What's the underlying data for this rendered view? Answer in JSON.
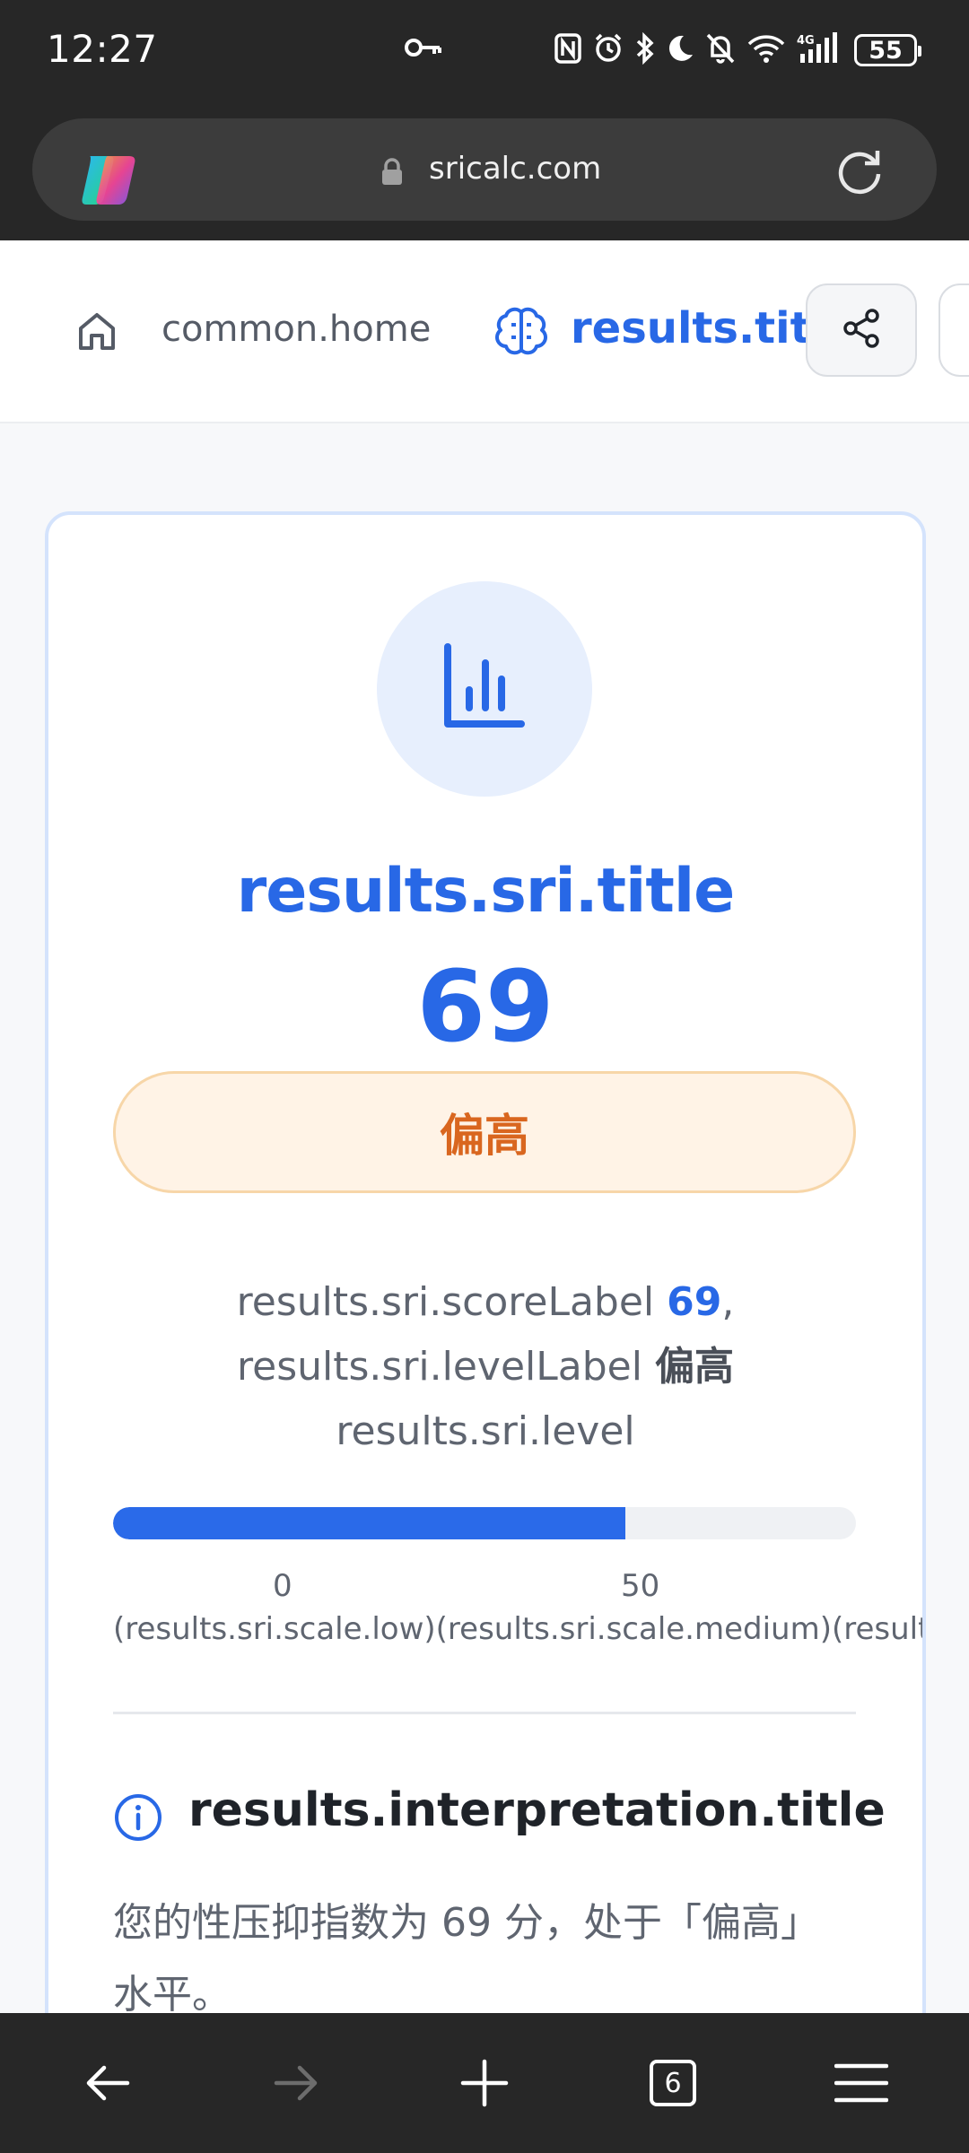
{
  "status_bar": {
    "time": "12:27",
    "battery": "55"
  },
  "browser": {
    "url": "sricalc.com",
    "tab_count": "6"
  },
  "nav": {
    "home_label": "common.home",
    "results_label": "results.title"
  },
  "result_card": {
    "title": "results.sri.title",
    "score": "69",
    "level": "偏高",
    "description": {
      "score_label": "results.sri.scoreLabel",
      "score_value": "69",
      "comma": ",",
      "level_label": "results.sri.levelLabel",
      "level_value": "偏高",
      "level_suffix": "results.sri.level"
    },
    "progress_fraction": 0.69,
    "scale": {
      "low_num": "0",
      "mid_num": "50",
      "labels": "(results.sri.scale.low)(results.sri.scale.medium)(results.sri.scale.high)"
    },
    "interpretation": {
      "title": "results.interpretation.title",
      "body": "您的性压抑指数为 69 分，处于「偏高」水平。"
    }
  },
  "colors": {
    "accent": "#2868e6",
    "level_orange": "#d9661f",
    "level_bg": "#fff3e6"
  },
  "icons": [
    "key-icon",
    "nfc-icon",
    "alarm-icon",
    "bluetooth-icon",
    "moon-icon",
    "mute-icon",
    "wifi-icon",
    "signal-icon",
    "battery-icon",
    "copilot-logo",
    "lock-icon",
    "reload-icon",
    "home-icon",
    "brain-icon",
    "share-icon",
    "bar-chart-icon",
    "info-icon",
    "back-icon",
    "forward-icon",
    "new-tab-icon",
    "tabs-icon",
    "menu-icon"
  ]
}
